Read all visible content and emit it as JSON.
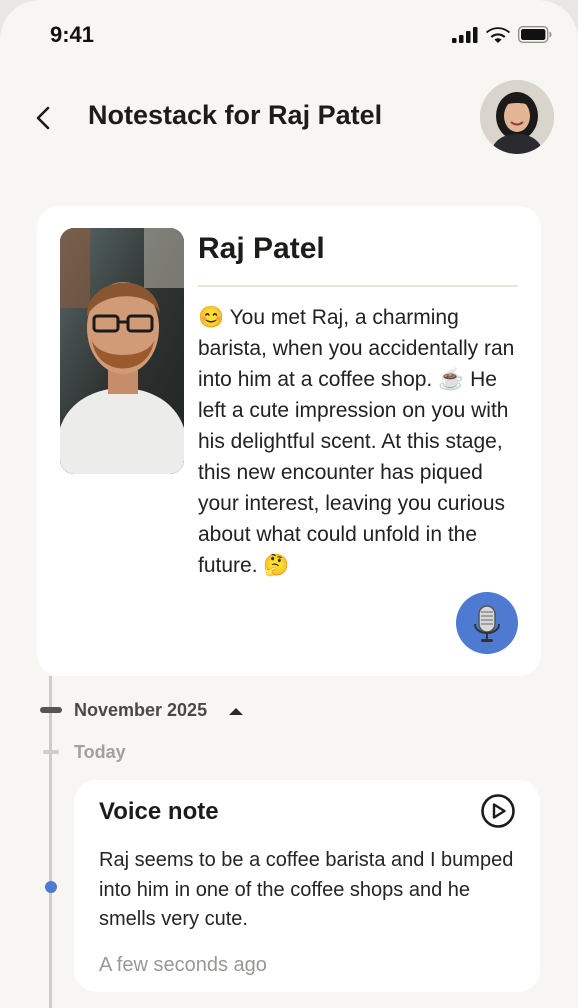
{
  "status_bar": {
    "time": "9:41"
  },
  "header": {
    "title": "Notestack for Raj Patel"
  },
  "profile": {
    "name": "Raj Patel",
    "bio": "😊 You met Raj, a charming barista, when you accidentally ran into him at a coffee shop. ☕ He left a cute impression on you with his delightful scent. At this stage, this new encounter has piqued your interest, leaving you curious about what could unfold in the future. 🤔"
  },
  "timeline": {
    "month": "November 2025",
    "day": "Today"
  },
  "note": {
    "title": "Voice note",
    "text": "Raj seems to be a coffee barista and I bumped into him in one of the coffee shops and he smells very cute.",
    "time": "A few seconds ago"
  },
  "colors": {
    "accent": "#4f7ad1",
    "background": "#f7f6f3",
    "card": "#ffffff"
  }
}
